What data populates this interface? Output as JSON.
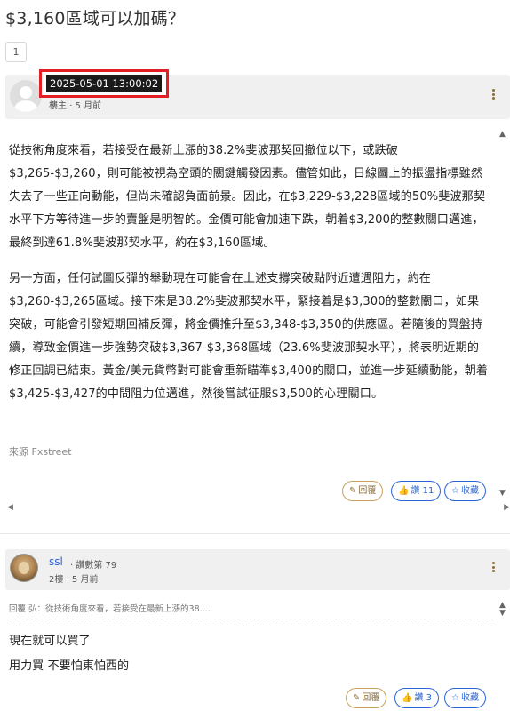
{
  "thread": {
    "title": "$3,160區域可以加碼？",
    "page_number": "1"
  },
  "post": {
    "timestamp": "2025-05-01 13:00:02",
    "author_role": "樓主",
    "time_ago": "5 月前",
    "paragraphs": [
      "從技術角度來看，若接受在最新上漲的38.2%斐波那契回撤位以下，或跌破$3,265-$3,260，則可能被視為空頭的關鍵觸發因素。儘管如此，日線圖上的振盪指標雖然失去了一些正向動能，但尚未確認負面前景。因此，在$3,229-$3,228區域的50%斐波那契水平下方等待進一步的賣盤是明智的。金價可能會加速下跌，朝着$3,200的整數關口邁進，最終到達61.8%斐波那契水平，約在$3,160區域。",
      "另一方面，任何試圖反彈的舉動現在可能會在上述支撐突破點附近遭遇阻力，約在$3,260-$3,265區域。接下來是38.2%斐波那契水平，緊接着是$3,300的整數關口，如果突破，可能會引發短期回補反彈，將金價推升至$3,348-$3,350的供應區。若隨後的買盤持續，導致金價進一步強勢突破$3,367-$3,368區域（23.6%斐波那契水平），將表明近期的修正回調已結束。黃金/美元貨幣對可能會重新瞄準$3,400的關口，並進一步延續動能，朝着$3,425-$3,427的中間阻力位邁進，然後嘗試征服$3,500的心理關口。"
    ],
    "source": "來源 Fxstreet",
    "reply_label": "回覆",
    "like_label": "讚 11",
    "save_label": "收藏"
  },
  "reply1": {
    "username": "ssl",
    "rank": "· 讚數第 79",
    "floor": "2樓",
    "time_ago": "5 月前",
    "quote": "回覆 弘：從技術角度來看，若接受在最新上漲的38....",
    "lines": [
      "現在就可以買了",
      "用力買 不要怕東怕西的"
    ],
    "reply_label": "回覆",
    "like_label": "讚 3",
    "save_label": "收藏"
  },
  "colors": {
    "accent_blue": "#2a64d6",
    "reply_gold": "#c6a15b",
    "highlight_red": "#e41e25"
  }
}
